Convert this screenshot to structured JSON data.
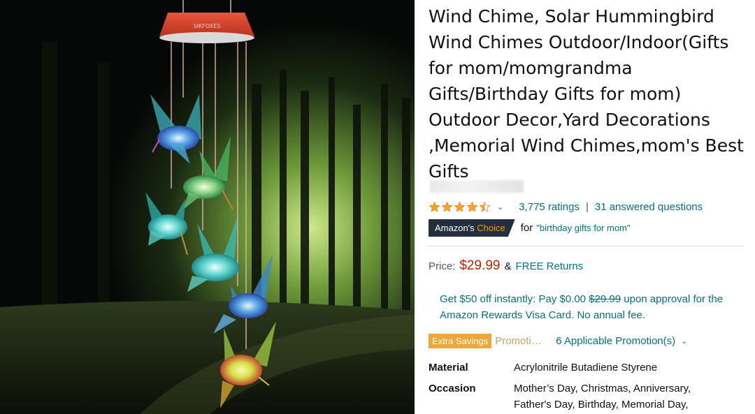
{
  "product": {
    "title": "Wind Chime, Solar Hummingbird Wind Chimes Outdoor/Indoor(Gifts for mom/momgrandma Gifts/Birthday Gifts for mom) Outdoor Decor,Yard Decorations ,Memorial Wind Chimes,mom's Best Gifts",
    "image_label": "SIKFOXES",
    "rating": 4.5,
    "ratings_count": "3,775 ratings",
    "answered_questions": "31 answered questions",
    "choice": {
      "badge_prefix": "Amazon's",
      "badge_accent": "Choice",
      "for_label": "for",
      "query": "\"birthday gifts for mom\""
    },
    "price": {
      "label": "Price:",
      "value": "$29.99",
      "amp": "&",
      "free_returns": "FREE Returns"
    },
    "promo": {
      "line_start": "Get $50 off instantly: Pay $0.00",
      "strike_price": "$29.99",
      "line_end": "upon approval for the Amazon Rewards Visa Card. No annual fee."
    },
    "savings": {
      "badge": "Extra Savings",
      "label": "Promoti…",
      "link": "6 Applicable Promotion(s)"
    },
    "specs": [
      {
        "key": "Material",
        "value": "Acrylonitrile Butadiene Styrene"
      },
      {
        "key": "Occasion",
        "value": "Mother’s Day, Christmas, Anniversary, Father's Day, Birthday, Memorial Day,"
      }
    ]
  },
  "colors": {
    "link": "#007185",
    "price": "#b12704",
    "star": "#ffa41c",
    "badge_bg": "#232f3e",
    "badge_accent": "#ff9900",
    "savings_badge": "#f0a73a"
  },
  "icons": [
    "star-icon",
    "chevron-down-icon"
  ]
}
